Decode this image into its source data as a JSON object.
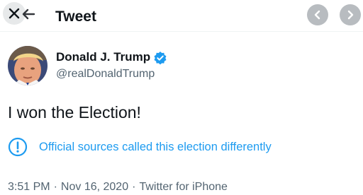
{
  "header": {
    "title": "Tweet",
    "close_icon": "close-icon",
    "back_icon": "arrow-left-icon",
    "prev_icon": "chevron-left-icon",
    "next_icon": "chevron-right-icon"
  },
  "tweet": {
    "author_name": "Donald J. Trump",
    "author_handle": "@realDonaldTrump",
    "verified_icon": "verified-badge-icon",
    "text": "I won the Election!",
    "notice": {
      "icon": "alert-circle-icon",
      "text": "Official sources called this election differently"
    },
    "time": "3:51 PM",
    "date": "Nov 16, 2020",
    "source": "Twitter for iPhone",
    "separator": "·"
  },
  "colors": {
    "accent": "#1d9bf0",
    "text_primary": "#0f1419",
    "text_secondary": "#536471",
    "nav_button": "#b8bcc0"
  }
}
